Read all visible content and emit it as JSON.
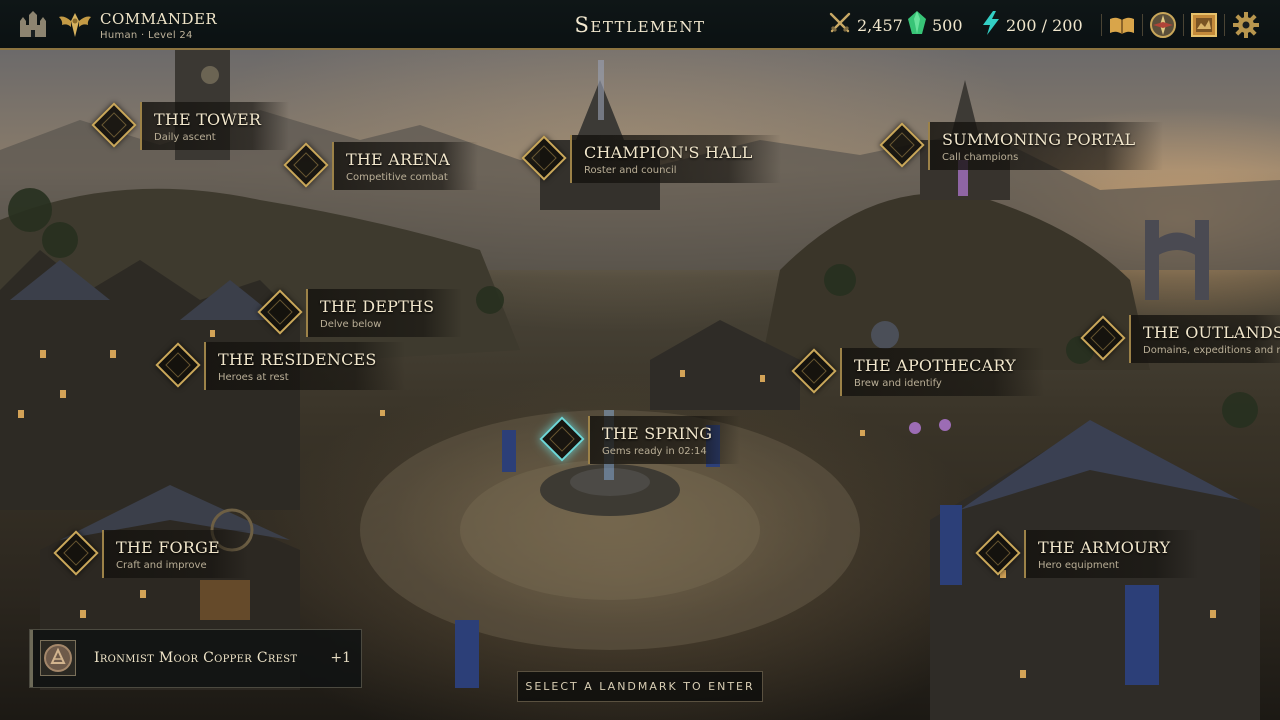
{
  "header": {
    "player_name": "COMMANDER",
    "player_sub": "Human · Level 24",
    "title": "Settlement"
  },
  "resources": [
    {
      "icon": "crossed-swords-icon",
      "value": "2,457"
    },
    {
      "icon": "green-gem-icon",
      "value": "500"
    },
    {
      "icon": "energy-bolt-icon",
      "value": "200 / 200"
    }
  ],
  "toolbar": {
    "buttons": [
      "open-book-icon",
      "compass-icon",
      "map-icon",
      "gear-icon"
    ]
  },
  "landmarks": [
    {
      "name": "THE TOWER",
      "desc": "Daily ascent"
    },
    {
      "name": "THE ARENA",
      "desc": "Competitive combat"
    },
    {
      "name": "CHAMPION'S HALL",
      "desc": "Roster and council"
    },
    {
      "name": "SUMMONING PORTAL",
      "desc": "Call champions"
    },
    {
      "name": "THE DEPTHS",
      "desc": "Delve below"
    },
    {
      "name": "THE RESIDENCES",
      "desc": "Heroes at rest"
    },
    {
      "name": "THE OUTLANDS",
      "desc": "Domains, expeditions and mor"
    },
    {
      "name": "THE APOTHECARY",
      "desc": "Brew and identify"
    },
    {
      "name": "THE SPRING",
      "desc": "Gems ready in 02:14"
    },
    {
      "name": "THE FORGE",
      "desc": "Craft and improve"
    },
    {
      "name": "THE ARMOURY",
      "desc": "Hero equipment"
    }
  ],
  "reward": {
    "name": "Ironmist Moor Copper Crest",
    "count": "+1"
  },
  "hint": "SELECT A LANDMARK TO ENTER",
  "colors": {
    "gold_accent": "#c9a75a",
    "active_glow": "#6fd8d8",
    "gem_green": "#3fcf7a",
    "energy_cyan": "#35d0c8"
  }
}
